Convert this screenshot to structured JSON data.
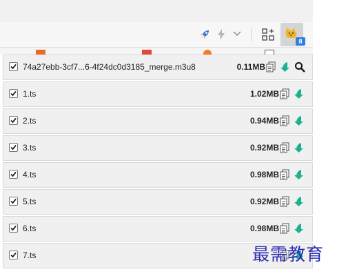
{
  "browser": {
    "extension_badge_count": "8",
    "toolbar_icons": [
      "rocket-icon",
      "lightning-icon",
      "chevron-down-icon",
      "apps-grid-icon",
      "cat-extension-icon"
    ]
  },
  "colors": {
    "badge": "#2f7fe0",
    "download_arrow": "#1bb38f",
    "row_bg": "#f0f0f0",
    "watermark": "#2a2fb0"
  },
  "files": [
    {
      "name": "74a27ebb-3cf7...6-4f24dc0d3185_merge.m3u8",
      "size": "0.11MB",
      "checked": true,
      "has_search": true
    },
    {
      "name": "1.ts",
      "size": "1.02MB",
      "checked": true
    },
    {
      "name": "2.ts",
      "size": "0.94MB",
      "checked": true
    },
    {
      "name": "3.ts",
      "size": "0.92MB",
      "checked": true
    },
    {
      "name": "4.ts",
      "size": "0.98MB",
      "checked": true
    },
    {
      "name": "5.ts",
      "size": "0.92MB",
      "checked": true
    },
    {
      "name": "6.ts",
      "size": "0.98MB",
      "checked": true
    },
    {
      "name": "7.ts",
      "size": "",
      "checked": true
    }
  ],
  "watermark": {
    "text": "最需教育"
  }
}
